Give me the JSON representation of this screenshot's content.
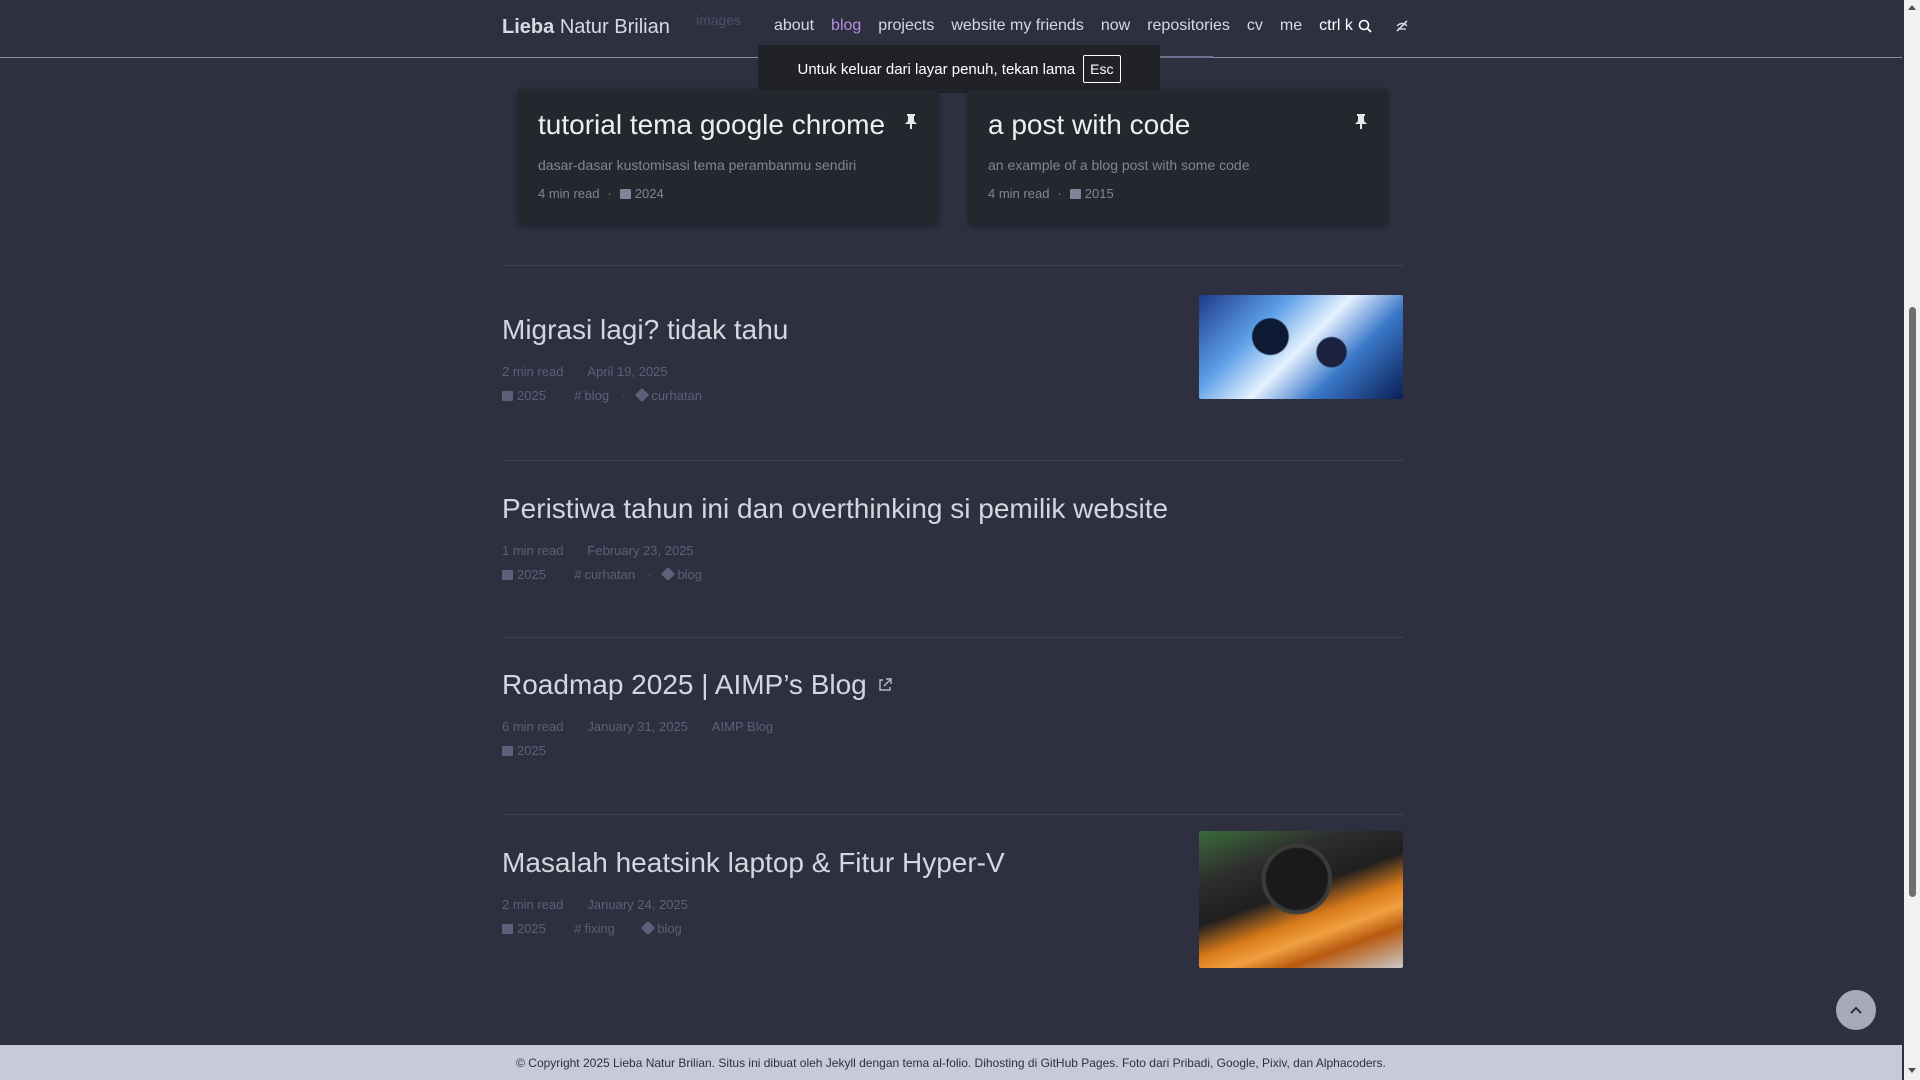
{
  "brand": {
    "first": "Lieba",
    "rest": "Natur Brilian"
  },
  "ghost_text": "images",
  "nav": {
    "items": [
      "about",
      "blog",
      "projects",
      "website my friends",
      "now",
      "repositories",
      "cv",
      "me"
    ],
    "search_label": "ctrl k"
  },
  "toast": {
    "message": "Untuk keluar dari layar penuh, tekan lama",
    "key": "Esc"
  },
  "pinned": [
    {
      "title": "tutorial tema google chrome",
      "desc": "dasar-dasar kustomisasi tema perambanmu sendiri",
      "read": "4 min read",
      "year": "2024"
    },
    {
      "title": "a post with code",
      "desc": "an example of a blog post with some code",
      "read": "4 min read",
      "year": "2015"
    }
  ],
  "posts": [
    {
      "title": "Migrasi lagi? tidak tahu",
      "read": "2 min read",
      "date": "April 19, 2025",
      "year": "2025",
      "category": "blog",
      "tag": "curhatan"
    },
    {
      "title": "Peristiwa tahun ini dan overthinking si pemilik website",
      "read": "1 min read",
      "date": "February 23, 2025",
      "year": "2025",
      "category": "curhatan",
      "tag": "blog"
    },
    {
      "title": "Roadmap 2025 | AIMP’s Blog",
      "read": "6 min read",
      "date": "January 31, 2025",
      "source": "AIMP Blog",
      "year": "2025"
    },
    {
      "title": "Masalah heatsink laptop & Fitur Hyper-V",
      "read": "2 min read",
      "date": "January 24, 2025",
      "year": "2025",
      "category": "fixing",
      "tag": "blog"
    }
  ],
  "footer": "© Copyright 2025 Lieba Natur Brilian. Situs ini dibuat oleh Jekyll dengan tema al-folio. Dihosting di GitHub Pages. Foto dari Pribadi, Google, Pixiv, dan Alphacoders.",
  "colors": {
    "background": "#2e3040",
    "accent": "#b78fe0",
    "card": "#25272e",
    "footer": "#c8cad8"
  },
  "icons": [
    "search-icon",
    "theme-toggle-icon",
    "pin-icon",
    "calendar-icon",
    "tag-icon",
    "external-link-icon",
    "chevron-up-icon"
  ]
}
